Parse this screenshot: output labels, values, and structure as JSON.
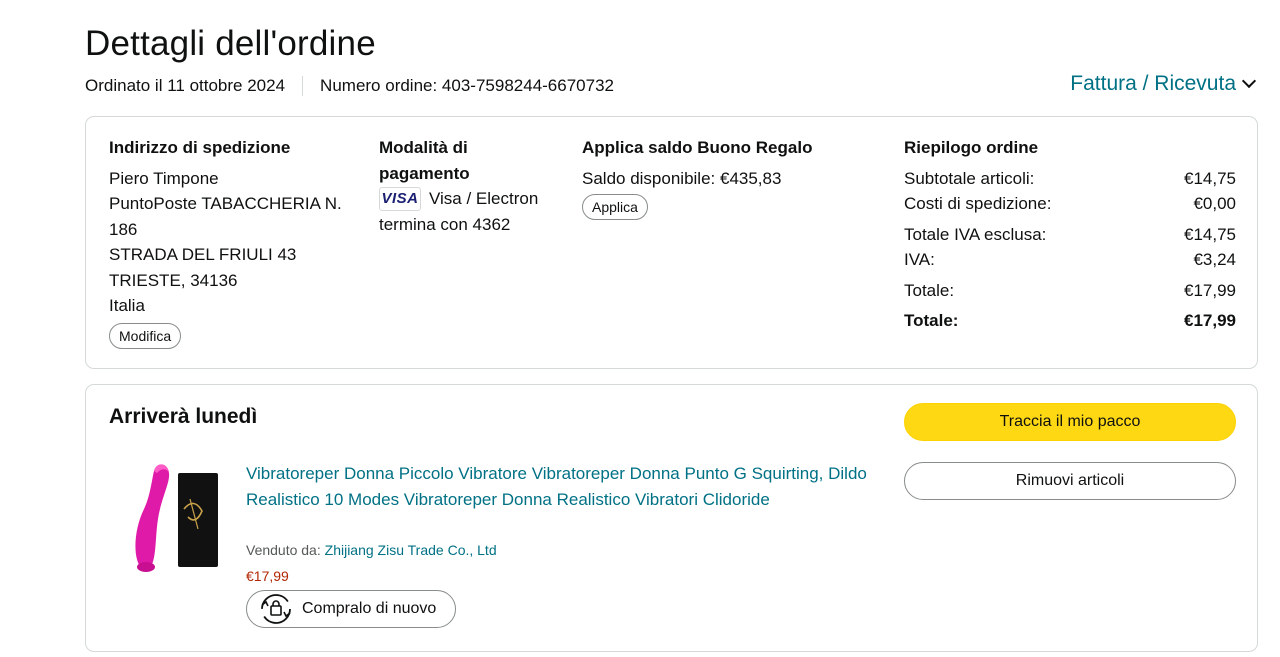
{
  "header": {
    "title": "Dettagli dell'ordine",
    "ordered_on": "Ordinato il 11 ottobre 2024",
    "order_number": "Numero ordine: 403-7598244-6670732",
    "invoice_link": "Fattura / Ricevuta"
  },
  "shipping": {
    "heading": "Indirizzo di spedizione",
    "lines": [
      "Piero Timpone",
      "PuntoPoste TABACCHERIA N.",
      "186",
      "STRADA DEL FRIULI 43",
      "TRIESTE, 34136",
      "Italia"
    ],
    "edit_label": "Modifica"
  },
  "payment": {
    "heading_line1": "Modalità di",
    "heading_line2": "pagamento",
    "card_brand_icon": "visa-logo-icon",
    "card_brand_text": "VISA",
    "card_type": "Visa / Electron",
    "card_ending": "termina con 4362"
  },
  "gift_card": {
    "heading": "Applica saldo Buono Regalo",
    "balance": "Saldo disponibile: €435,83",
    "apply_label": "Applica"
  },
  "summary": {
    "heading": "Riepilogo ordine",
    "rows": [
      {
        "label": "Subtotale articoli:",
        "value": "€14,75"
      },
      {
        "label": "Costi di spedizione:",
        "value": "€0,00"
      },
      {
        "label": "Totale IVA esclusa:",
        "value": "€14,75"
      },
      {
        "label": "IVA:",
        "value": "€3,24"
      },
      {
        "label": "Totale:",
        "value": "€17,99"
      },
      {
        "label": "Totale:",
        "value": "€17,99"
      }
    ]
  },
  "delivery": {
    "heading": "Arriverà lunedì",
    "track_label": "Traccia il mio pacco",
    "remove_label": "Rimuovi articoli",
    "product": {
      "title": "Vibratoreper Donna Piccolo Vibratore Vibratoreper Donna Punto G Squirting, Dildo Realistico 10 Modes Vibratoreper Donna Realistico Vibratori Clidoride",
      "sold_by_label": "Venduto da: ",
      "seller": "Zhijiang Zisu Trade Co., Ltd",
      "price": "€17,99",
      "buy_again_label": "Compralo di nuovo"
    }
  },
  "colors": {
    "link": "#007185",
    "price": "#b12704",
    "primary_button": "#ffd814",
    "border": "#d5d9d9"
  }
}
